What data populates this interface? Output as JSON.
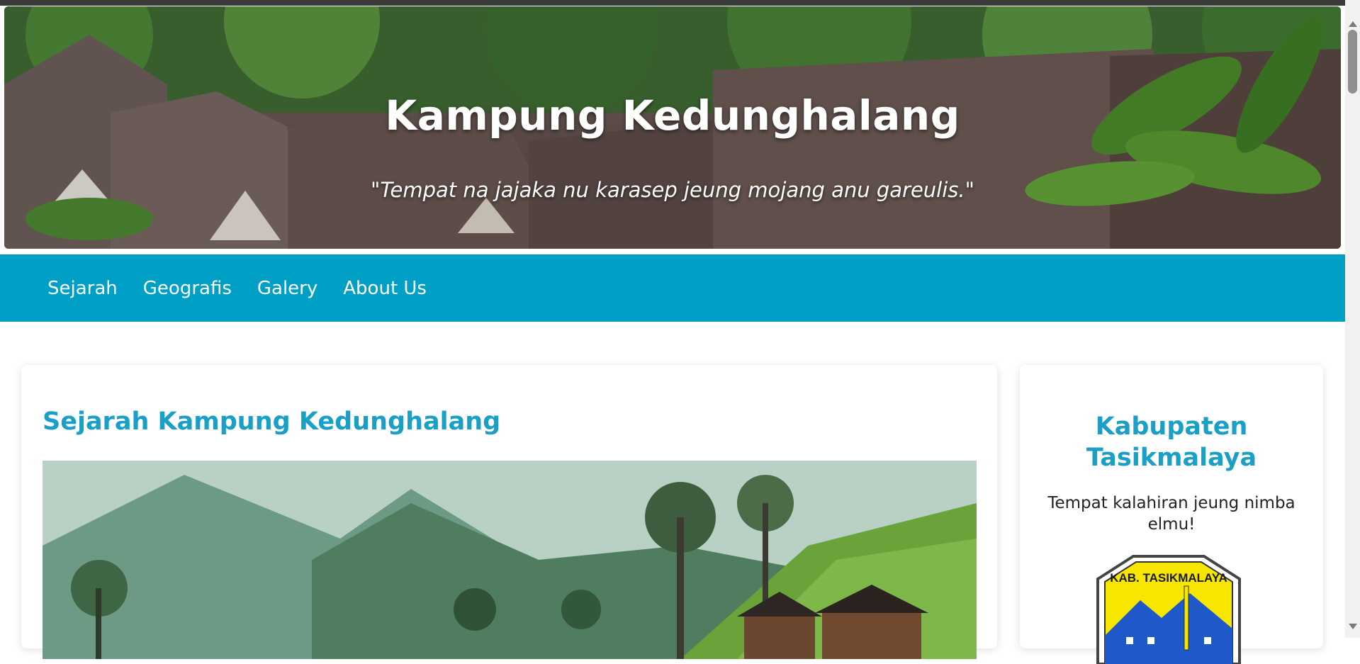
{
  "hero": {
    "title": "Kampung Kedunghalang",
    "tagline": "\"Tempat na jajaka nu karasep jeung mojang anu gareulis.\""
  },
  "nav": {
    "items": [
      {
        "label": "Sejarah"
      },
      {
        "label": "Geografis"
      },
      {
        "label": "Galery"
      },
      {
        "label": "About Us"
      }
    ]
  },
  "main": {
    "title": "Sejarah Kampung Kedunghalang"
  },
  "sidebar": {
    "title": "Kabupaten Tasikmalaya",
    "text": "Tempat kalahiran jeung nimba elmu!",
    "logo_text": "KAB. TASIKMALAYA"
  },
  "colors": {
    "accent": "#00a0c6",
    "heading": "#1a9fc7"
  }
}
